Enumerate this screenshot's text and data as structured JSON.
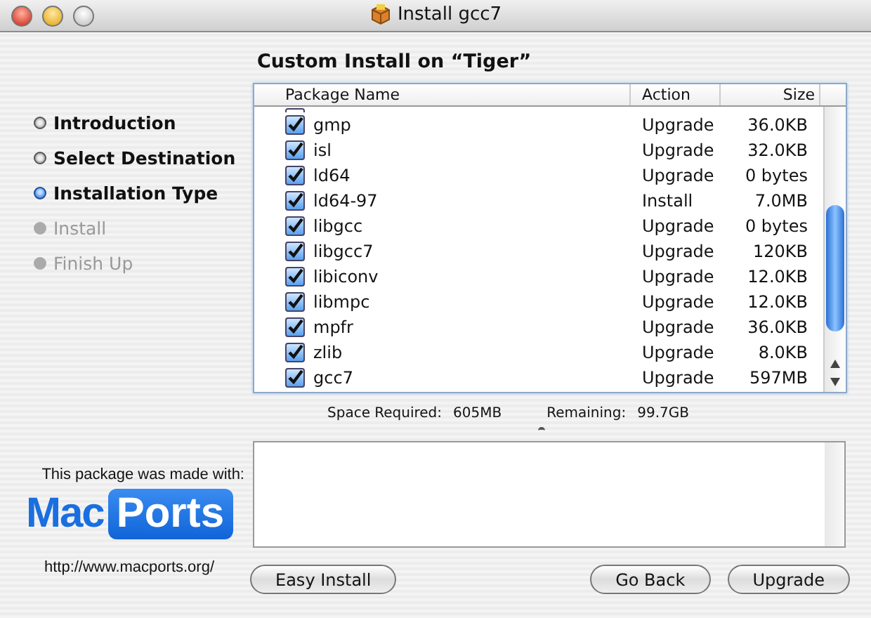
{
  "window": {
    "title": "Install gcc7"
  },
  "heading": "Custom Install on “Tiger”",
  "steps": [
    {
      "label": "Introduction",
      "selected": false,
      "disabled": false
    },
    {
      "label": "Select Destination",
      "selected": false,
      "disabled": false
    },
    {
      "label": "Installation Type",
      "selected": true,
      "disabled": false
    },
    {
      "label": "Install",
      "selected": false,
      "disabled": true
    },
    {
      "label": "Finish Up",
      "selected": false,
      "disabled": true
    }
  ],
  "table": {
    "columns": [
      "Package Name",
      "Action",
      "Size"
    ],
    "rows": [
      {
        "name": "gmp",
        "action": "Upgrade",
        "size": "36.0KB",
        "checked": true
      },
      {
        "name": "isl",
        "action": "Upgrade",
        "size": "32.0KB",
        "checked": true
      },
      {
        "name": "ld64",
        "action": "Upgrade",
        "size": "0 bytes",
        "checked": true
      },
      {
        "name": "ld64-97",
        "action": "Install",
        "size": "7.0MB",
        "checked": true
      },
      {
        "name": "libgcc",
        "action": "Upgrade",
        "size": "0 bytes",
        "checked": true
      },
      {
        "name": "libgcc7",
        "action": "Upgrade",
        "size": "120KB",
        "checked": true
      },
      {
        "name": "libiconv",
        "action": "Upgrade",
        "size": "12.0KB",
        "checked": true
      },
      {
        "name": "libmpc",
        "action": "Upgrade",
        "size": "12.0KB",
        "checked": true
      },
      {
        "name": "mpfr",
        "action": "Upgrade",
        "size": "36.0KB",
        "checked": true
      },
      {
        "name": "zlib",
        "action": "Upgrade",
        "size": "8.0KB",
        "checked": true
      },
      {
        "name": "gcc7",
        "action": "Upgrade",
        "size": "597MB",
        "checked": true
      }
    ]
  },
  "space": {
    "required_label": "Space Required:",
    "required": "605MB",
    "remaining_label": "Remaining:",
    "remaining": "99.7GB"
  },
  "branding": {
    "caption": "This package was made with:",
    "logo_left": "Mac",
    "logo_right": "Ports",
    "url": "http://www.macports.org/"
  },
  "buttons": {
    "left": "Easy Install",
    "back": "Go Back",
    "next": "Upgrade"
  }
}
